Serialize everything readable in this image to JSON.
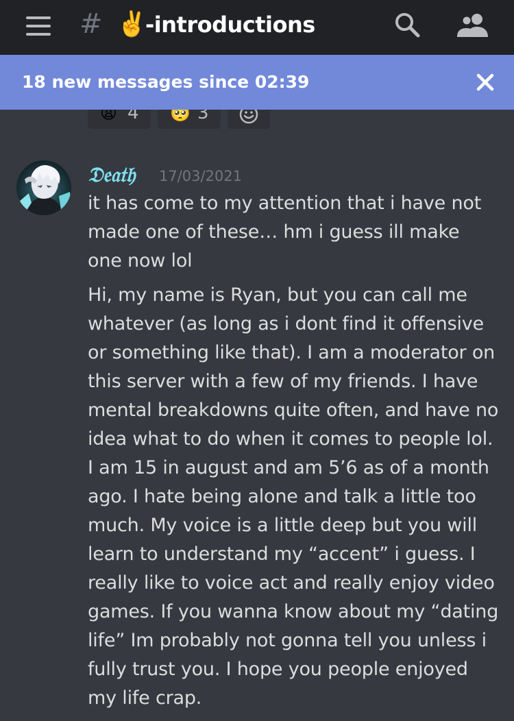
{
  "header": {
    "channel_emoji": "✌️",
    "channel_name": "-introductions",
    "hash_symbol": "#",
    "icons": [
      "hamburger-menu-icon",
      "hash-icon",
      "search-icon",
      "members-icon"
    ]
  },
  "banner": {
    "text": "18 new messages since 02:39",
    "background_color": "#7289da",
    "close_icon": "close-icon"
  },
  "reactions": [
    {
      "emoji": "😩",
      "count": "4"
    },
    {
      "emoji": "🥺",
      "count": "3"
    },
    {
      "emoji": "add-reaction-icon",
      "count": ""
    }
  ],
  "message": {
    "author": "𝔇𝔢𝔞𝔱𝔥",
    "author_color": "#7ee0f2",
    "timestamp": "17/03/2021",
    "avatar": "anime-character-avatar",
    "paragraphs": [
      "it has come to my attention that i have not made one of these… hm i guess ill make one now lol",
      "Hi, my name is Ryan, but you can call me whatever (as long as i dont find it offensive or something like that). I am a moderator on this server with a few of my friends. I have mental breakdowns quite often, and have no idea what to do when it comes to people lol. I am 15 in august and am 5’6 as of a month ago. I hate being alone and talk a little too much. My voice is a little deep but you will learn to understand my “accent” i guess. I really like to voice act and really enjoy video games. If you wanna know about my “dating life” Im probably not gonna tell you unless i fully trust you. I hope you people enjoyed my life crap."
    ]
  },
  "colors": {
    "app_background": "#36393f",
    "topbar_background": "#202225",
    "text_primary": "#dcddde",
    "text_muted": "#72767d"
  }
}
